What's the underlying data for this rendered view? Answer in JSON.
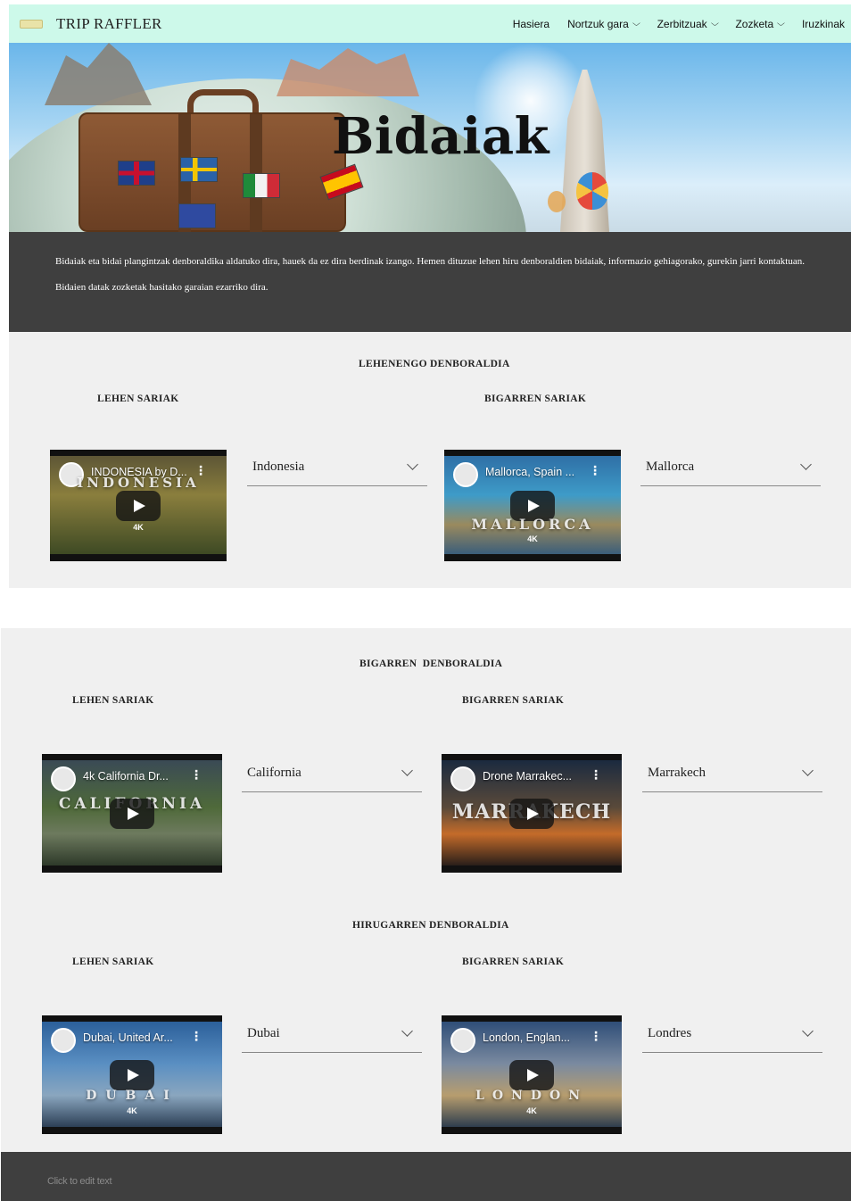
{
  "header": {
    "brand": "TRIP RAFFLER",
    "nav": [
      {
        "label": "Hasiera",
        "has_dropdown": false
      },
      {
        "label": "Nortzuk gara",
        "has_dropdown": true
      },
      {
        "label": "Zerbitzuak",
        "has_dropdown": true
      },
      {
        "label": "Zozketa",
        "has_dropdown": true
      },
      {
        "label": "Iruzkinak",
        "has_dropdown": false
      }
    ],
    "bg_color": "#cdf9ea"
  },
  "hero": {
    "title": "Bidaiak"
  },
  "intro": {
    "paragraph1": "Bidaiak eta bidai plangintzak denboraldika aldatuko dira, hauek da ez dira berdinak izango. Hemen dituzue lehen hiru denboraldien bidaiak, informazio gehiagorako, gurekin jarri kontaktuan.",
    "paragraph2": "Bidaien datak zozketak hasitako garaian ezarriko dira."
  },
  "seasons": [
    {
      "title": "LEHENENGO DENBORALDIA",
      "first_prize_label": "LEHEN SARIAK",
      "second_prize_label": "BIGARREN SARIAK",
      "first_video": {
        "title": "INDONESIA by D...",
        "overlay": "INDONESIA",
        "badge": "4K"
      },
      "first_select": "Indonesia",
      "second_video": {
        "title": "Mallorca, Spain ...",
        "overlay": "MALLORCA",
        "badge": "4K"
      },
      "second_select": "Mallorca"
    },
    {
      "title": "BIGARREN  DENBORALDIA",
      "first_prize_label": "LEHEN SARIAK",
      "second_prize_label": "BIGARREN SARIAK",
      "first_video": {
        "title": "4k California Dr...",
        "overlay": "CALIFORNIA",
        "badge": ""
      },
      "first_select": "California",
      "second_video": {
        "title": "Drone Marrakec...",
        "overlay": "MARRAKECH",
        "badge": ""
      },
      "second_select": "Marrakech"
    },
    {
      "title": "HIRUGARREN DENBORALDIA",
      "first_prize_label": "LEHEN SARIAK",
      "second_prize_label": "BIGARREN SARIAK",
      "first_video": {
        "title": "Dubai, United Ar...",
        "overlay": "DUBAI",
        "badge": "4K"
      },
      "first_select": "Dubai",
      "second_video": {
        "title": "London, Englan...",
        "overlay": "LONDON",
        "badge": "4K"
      },
      "second_select": "Londres"
    }
  ],
  "footer": {
    "text": "Click to edit text"
  },
  "colors": {
    "dark_band": "#3f3f3f",
    "panel": "#f0f0f0"
  }
}
